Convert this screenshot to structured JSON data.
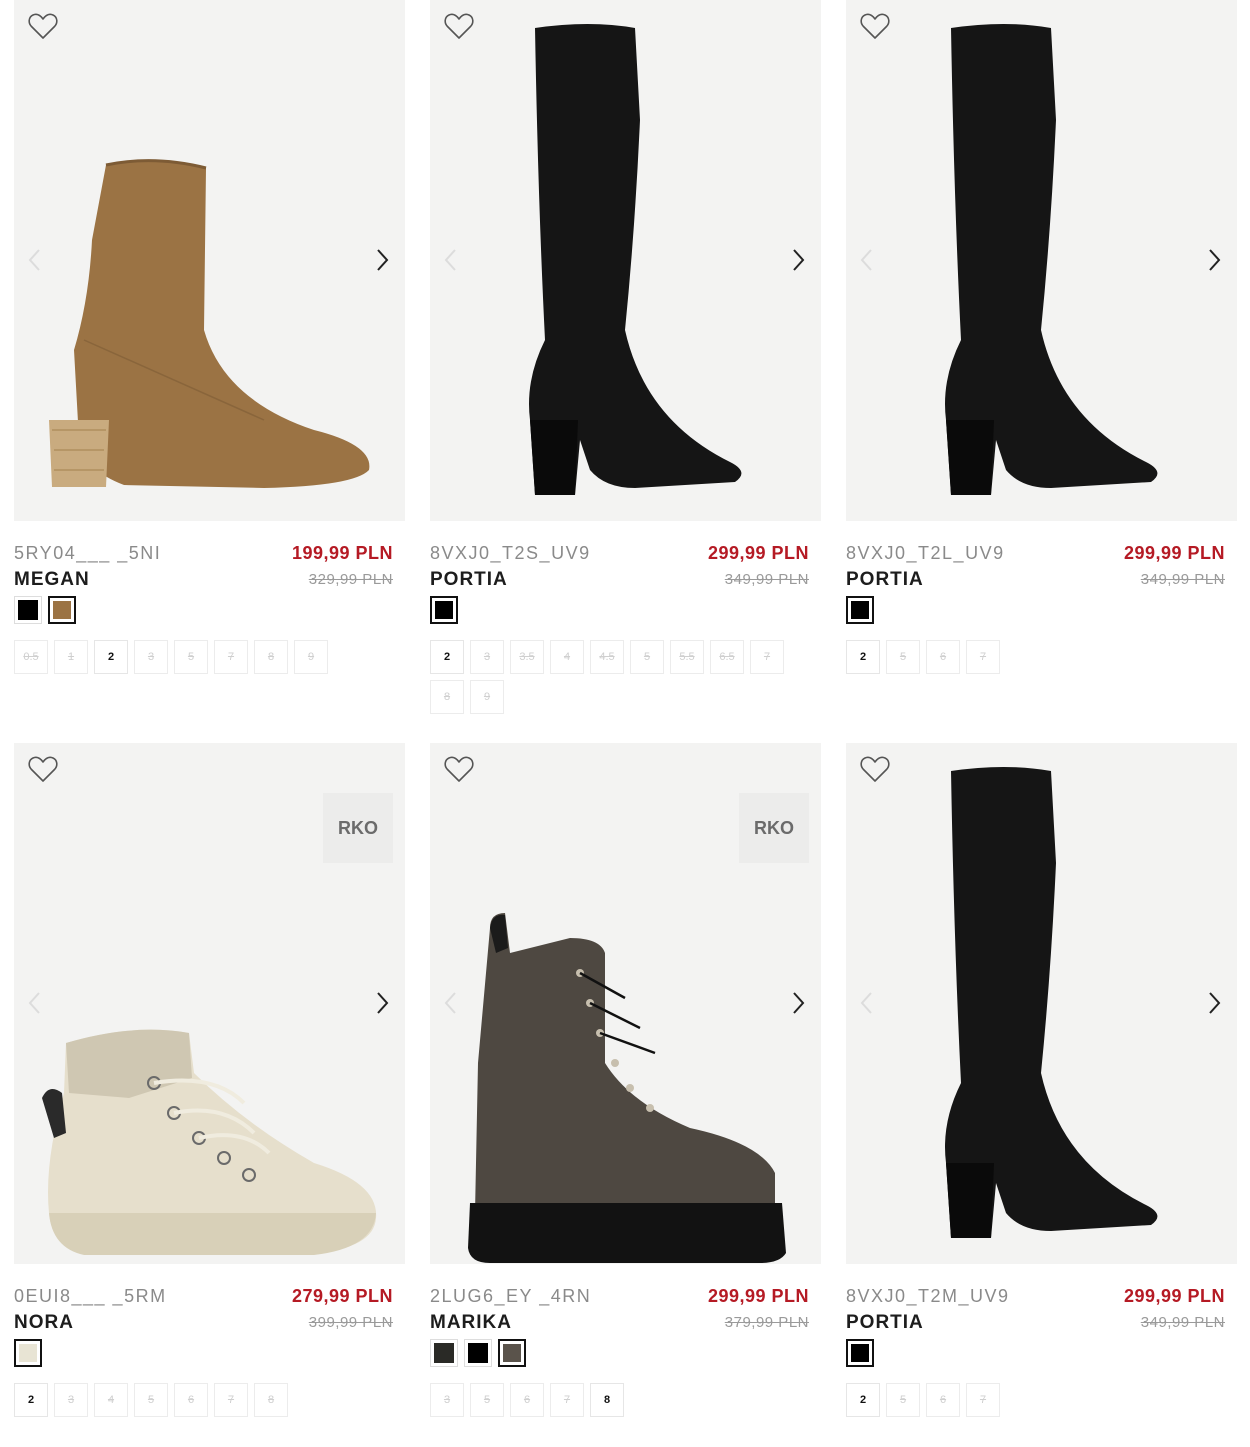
{
  "colors": {
    "price": "#b51a24",
    "old_price": "#9a9a9a",
    "image_bg": "#f3f3f2"
  },
  "products": [
    {
      "code": "5RY04___ _5NI",
      "name": "MEGAN",
      "price": "199,99 PLN",
      "old_price": "329,99 PLN",
      "badge": "",
      "shoe": "tan-ankle-boot",
      "swatches": [
        {
          "color": "#000000",
          "selected": false
        },
        {
          "color": "#9b7344",
          "selected": true
        }
      ],
      "sizes": [
        {
          "label": "0.5",
          "available": false
        },
        {
          "label": "1",
          "available": false
        },
        {
          "label": "2",
          "available": true
        },
        {
          "label": "3",
          "available": false
        },
        {
          "label": "5",
          "available": false
        },
        {
          "label": "7",
          "available": false
        },
        {
          "label": "8",
          "available": false
        },
        {
          "label": "9",
          "available": false
        }
      ]
    },
    {
      "code": "8VXJ0_T2S_UV9",
      "name": "PORTIA",
      "price": "299,99 PLN",
      "old_price": "349,99 PLN",
      "badge": "",
      "shoe": "black-knee-boot",
      "swatches": [
        {
          "color": "#000000",
          "selected": true
        }
      ],
      "sizes": [
        {
          "label": "2",
          "available": true
        },
        {
          "label": "3",
          "available": false
        },
        {
          "label": "3.5",
          "available": false
        },
        {
          "label": "4",
          "available": false
        },
        {
          "label": "4.5",
          "available": false
        },
        {
          "label": "5",
          "available": false
        },
        {
          "label": "5.5",
          "available": false
        },
        {
          "label": "6.5",
          "available": false
        },
        {
          "label": "7",
          "available": false
        },
        {
          "label": "8",
          "available": false
        },
        {
          "label": "9",
          "available": false
        }
      ]
    },
    {
      "code": "8VXJ0_T2L_UV9",
      "name": "PORTIA",
      "price": "299,99 PLN",
      "old_price": "349,99 PLN",
      "badge": "",
      "shoe": "black-knee-boot",
      "swatches": [
        {
          "color": "#000000",
          "selected": true
        }
      ],
      "sizes": [
        {
          "label": "2",
          "available": true
        },
        {
          "label": "5",
          "available": false
        },
        {
          "label": "6",
          "available": false
        },
        {
          "label": "7",
          "available": false
        }
      ]
    },
    {
      "code": "0EUI8___ _5RM",
      "name": "NORA",
      "price": "279,99 PLN",
      "old_price": "399,99 PLN",
      "badge": "RKO",
      "shoe": "cream-hiker",
      "swatches": [
        {
          "color": "#e8e4d4",
          "selected": true
        }
      ],
      "sizes": [
        {
          "label": "2",
          "available": true
        },
        {
          "label": "3",
          "available": false
        },
        {
          "label": "4",
          "available": false
        },
        {
          "label": "5",
          "available": false
        },
        {
          "label": "6",
          "available": false
        },
        {
          "label": "7",
          "available": false
        },
        {
          "label": "8",
          "available": false
        }
      ]
    },
    {
      "code": "2LUG6_EY _4RN",
      "name": "MARIKA",
      "price": "299,99 PLN",
      "old_price": "379,99 PLN",
      "badge": "RKO",
      "shoe": "brown-combat-boot",
      "swatches": [
        {
          "color": "#2a2a26",
          "selected": false
        },
        {
          "color": "#000000",
          "selected": false
        },
        {
          "color": "#5a534b",
          "selected": true
        }
      ],
      "sizes": [
        {
          "label": "3",
          "available": false
        },
        {
          "label": "5",
          "available": false
        },
        {
          "label": "6",
          "available": false
        },
        {
          "label": "7",
          "available": false
        },
        {
          "label": "8",
          "available": true
        }
      ]
    },
    {
      "code": "8VXJ0_T2M_UV9",
      "name": "PORTIA",
      "price": "299,99 PLN",
      "old_price": "349,99 PLN",
      "badge": "",
      "shoe": "black-knee-boot",
      "swatches": [
        {
          "color": "#000000",
          "selected": true
        }
      ],
      "sizes": [
        {
          "label": "2",
          "available": true
        },
        {
          "label": "5",
          "available": false
        },
        {
          "label": "6",
          "available": false
        },
        {
          "label": "7",
          "available": false
        }
      ]
    }
  ]
}
